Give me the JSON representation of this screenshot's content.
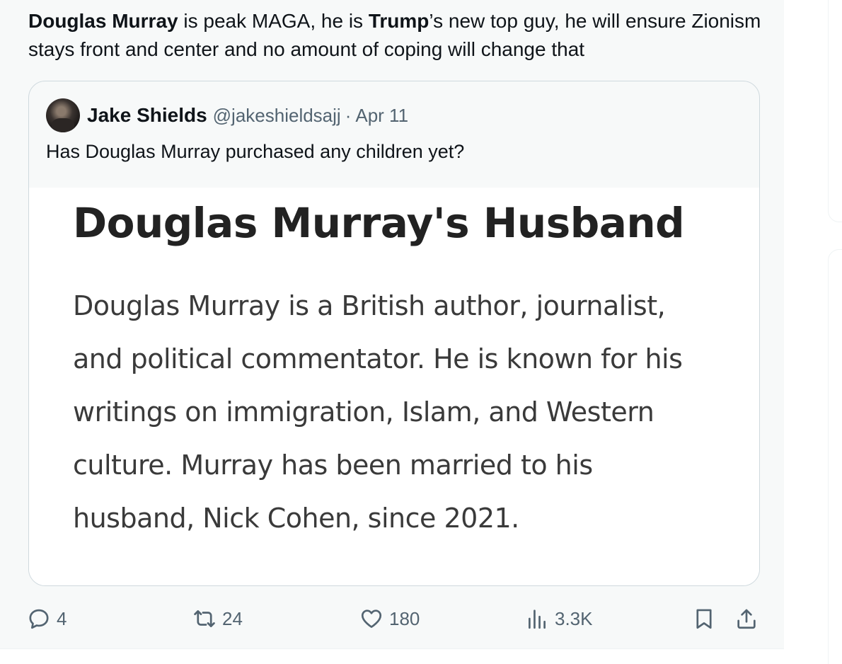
{
  "tweet": {
    "text_parts": {
      "name1": "Douglas Murray",
      "mid1": " is peak MAGA, he is ",
      "name2": "Trump",
      "mid2": "’s new top guy, he will ensure Zionism stays front and center and no amount of coping will change that"
    }
  },
  "quote": {
    "author_name": "Jake Shields",
    "author_handle": "@jakeshieldsajj",
    "separator": "·",
    "date": "Apr 11",
    "text": "Has Douglas Murray purchased any children yet?",
    "image": {
      "title": "Douglas Murray's Husband",
      "body_lines": [
        "Douglas Murray is a British author, journalist,",
        "and political commentator. He is known for his",
        "writings on immigration, Islam, and Western",
        "culture. Murray has been married to his",
        "husband, Nick Cohen, since 2021."
      ]
    }
  },
  "actions": {
    "reply_count": "4",
    "retweet_count": "24",
    "like_count": "180",
    "views_count": "3.3K"
  },
  "icons": {
    "reply": "reply-bubble-icon",
    "retweet": "retweet-icon",
    "like": "heart-icon",
    "views": "views-bar-chart-icon",
    "bookmark": "bookmark-icon",
    "share": "share-icon"
  },
  "colors": {
    "text_primary": "#0f1419",
    "text_secondary": "#536471",
    "border": "#cfd9de",
    "background": "#f7f9f9"
  }
}
